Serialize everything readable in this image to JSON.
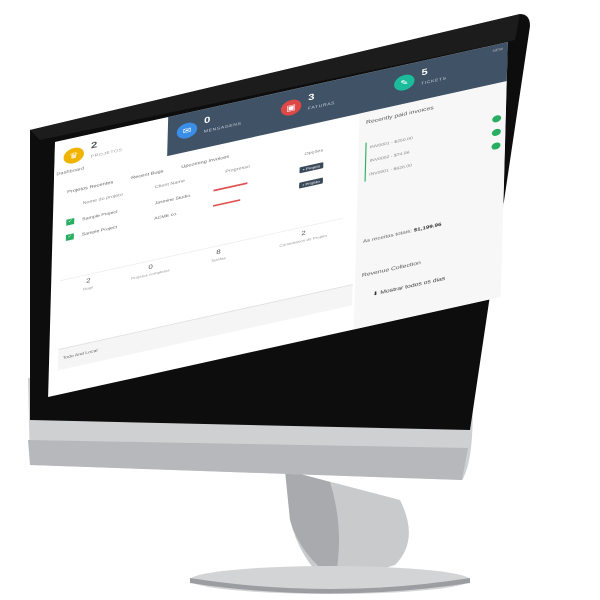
{
  "header": {
    "breadcrumb": "Dashboard",
    "status_label": "NEW"
  },
  "stats": [
    {
      "value": "2",
      "label": "PROJETOS",
      "icon": "trophy-icon",
      "color": "#f0b400"
    },
    {
      "value": "0",
      "label": "MENSAGENS",
      "icon": "envelope-icon",
      "color": "#3a8ee6"
    },
    {
      "value": "3",
      "label": "FATURAS",
      "icon": "briefcase-icon",
      "color": "#e04848"
    },
    {
      "value": "5",
      "label": "TICKETS",
      "icon": "ticket-icon",
      "color": "#1abc9c"
    }
  ],
  "projects": {
    "tabs": [
      "Projetos Recentes",
      "Recent Bugs",
      "Upcoming Invoices"
    ],
    "columns": [
      "Nome do projeto",
      "Client Name",
      "Progresso",
      "Opções"
    ],
    "rows": [
      {
        "name": "Sample Project",
        "client": "Jasmine Studio",
        "progress": 0.45,
        "action": "Projeto"
      },
      {
        "name": "Sample Project",
        "client": "ACME co.",
        "progress": 0.35,
        "action": "Projeto"
      }
    ]
  },
  "kpis": [
    {
      "value": "2",
      "label": "Bugs"
    },
    {
      "value": "0",
      "label": "Projetos completos"
    },
    {
      "value": "8",
      "label": "Tarefas"
    },
    {
      "value": "2",
      "label": "Comentarios do Projeto"
    }
  ],
  "invoices": {
    "title": "Recently paid invoices",
    "items": [
      "INV0001 - $250.00",
      "INV0002 - $74.96",
      "INV0001 - $626.00"
    ],
    "total_label": "As receitas totais:",
    "total_value": "$1,199.96"
  },
  "revenue": {
    "title": "Revenue Collection"
  },
  "footer": {
    "left_label": "Todo And Local",
    "show_all": "Mostrar todos os dias"
  },
  "colors": {
    "panel": "#3f5266",
    "green": "#27ae60",
    "red": "#e05050"
  }
}
